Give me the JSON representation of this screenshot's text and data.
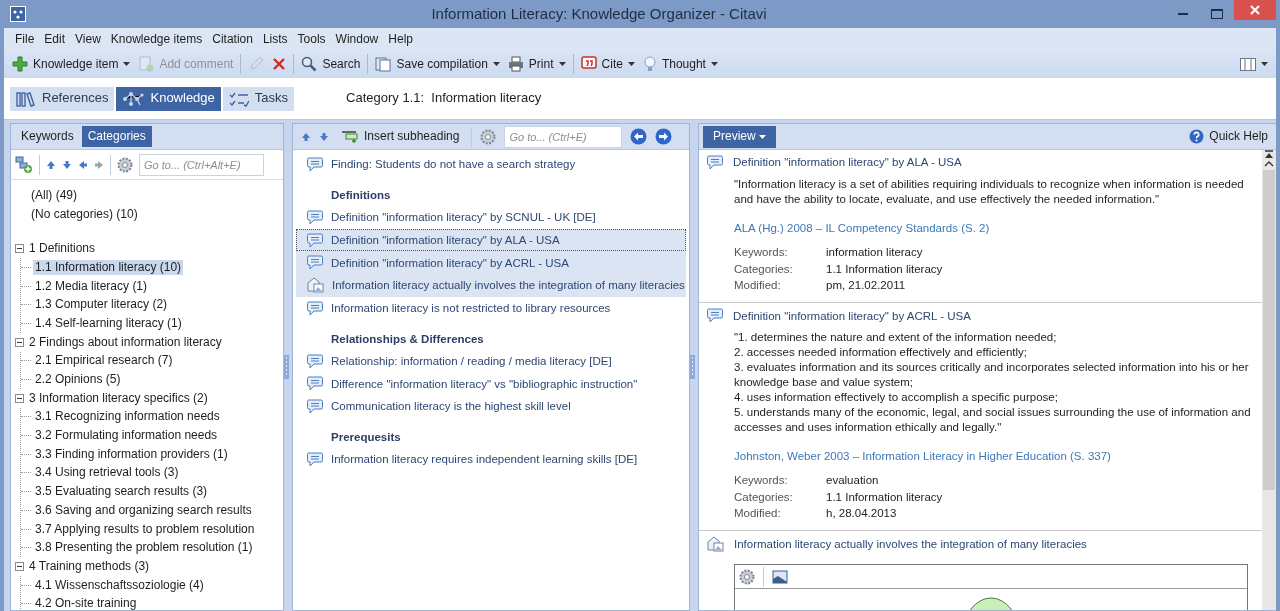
{
  "window": {
    "title": "Information Literacy: Knowledge Organizer - Citavi"
  },
  "menu": [
    "File",
    "Edit",
    "View",
    "Knowledge items",
    "Citation",
    "Lists",
    "Tools",
    "Window",
    "Help"
  ],
  "toolbar": [
    {
      "kind": "button",
      "label": "Knowledge item",
      "dropdown": true,
      "disabled": false
    },
    {
      "kind": "button",
      "label": "Add comment",
      "dropdown": false,
      "disabled": true
    },
    {
      "kind": "separator"
    },
    {
      "kind": "icon-button",
      "disabled": true
    },
    {
      "kind": "icon-button",
      "disabled": false
    },
    {
      "kind": "separator"
    },
    {
      "kind": "button",
      "label": "Search",
      "dropdown": false,
      "disabled": false
    },
    {
      "kind": "separator"
    },
    {
      "kind": "button",
      "label": "Save compilation",
      "dropdown": true,
      "disabled": false
    },
    {
      "kind": "button",
      "label": "Print",
      "dropdown": true,
      "disabled": false
    },
    {
      "kind": "separator"
    },
    {
      "kind": "button",
      "label": "Cite",
      "dropdown": true,
      "disabled": false
    },
    {
      "kind": "button",
      "label": "Thought",
      "dropdown": true,
      "disabled": false
    }
  ],
  "nav_tabs": [
    {
      "label": "References",
      "selected": false
    },
    {
      "label": "Knowledge",
      "selected": true
    },
    {
      "label": "Tasks",
      "selected": false
    }
  ],
  "heading": "Category 1.1:  Information literacy",
  "left": {
    "tabs": [
      {
        "label": "Keywords",
        "selected": false
      },
      {
        "label": "Categories",
        "selected": true
      }
    ],
    "goto_placeholder": "Go to... (Ctrl+Alt+E)",
    "tree": [
      {
        "label": "(All) (49)",
        "selected": false
      },
      {
        "label": "(No categories) (10)",
        "selected": false
      },
      {
        "label": "1 Definitions",
        "selected": false,
        "expanded": true,
        "children": [
          {
            "label": "1.1 Information literacy (10)",
            "selected": true
          },
          {
            "label": "1.2 Media literacy (1)",
            "selected": false
          },
          {
            "label": "1.3 Computer literacy (2)",
            "selected": false
          },
          {
            "label": "1.4 Self-learning literacy (1)",
            "selected": false
          }
        ]
      },
      {
        "label": "2 Findings about information literacy",
        "selected": false,
        "expanded": true,
        "children": [
          {
            "label": "2.1 Empirical research (7)",
            "selected": false
          },
          {
            "label": "2.2 Opinions (5)",
            "selected": false
          }
        ]
      },
      {
        "label": "3 Information literacy specifics (2)",
        "selected": false,
        "expanded": true,
        "children": [
          {
            "label": "3.1 Recognizing information needs",
            "selected": false
          },
          {
            "label": "3.2 Formulating information needs",
            "selected": false
          },
          {
            "label": "3.3 Finding information providers (1)",
            "selected": false
          },
          {
            "label": "3.4 Using retrieval tools (3)",
            "selected": false
          },
          {
            "label": "3.5 Evaluating search results (3)",
            "selected": false
          },
          {
            "label": "3.6 Saving and organizing search results",
            "selected": false
          },
          {
            "label": "3.7 Applying results to problem resolution",
            "selected": false
          },
          {
            "label": "3.8 Presenting the problem resolution (1)",
            "selected": false
          }
        ]
      },
      {
        "label": "4 Training methods (3)",
        "selected": false,
        "expanded": true,
        "children": [
          {
            "label": "4.1 Wissenschaftssoziologie (4)",
            "selected": false
          },
          {
            "label": "4.2 On-site training",
            "selected": false
          }
        ]
      }
    ]
  },
  "middle": {
    "insert_label": "Insert subheading",
    "goto_placeholder": "Go to... (Ctrl+E)",
    "items": [
      {
        "kind": "note",
        "label": "Finding: Students do not have a search strategy",
        "selected": false,
        "focused": false
      },
      {
        "kind": "heading",
        "label": "Definitions"
      },
      {
        "kind": "note",
        "label": "Definition \"information literacy\" by SCNUL - UK [DE]",
        "selected": false,
        "focused": false
      },
      {
        "kind": "note",
        "label": "Definition \"information literacy\" by ALA - USA",
        "selected": true,
        "focused": true
      },
      {
        "kind": "note",
        "label": "Definition \"information literacy\" by ACRL - USA",
        "selected": true,
        "focused": false
      },
      {
        "kind": "image-note",
        "label": "Information literacy actually involves the integration of many literacies",
        "selected": true,
        "focused": false
      },
      {
        "kind": "note",
        "label": "Information literacy is not restricted to library resources",
        "selected": false,
        "focused": false
      },
      {
        "kind": "heading",
        "label": "Relationships & Differences"
      },
      {
        "kind": "note",
        "label": "Relationship: information / reading / media literacy [DE]",
        "selected": false,
        "focused": false
      },
      {
        "kind": "note",
        "label": "Difference \"information literacy\" vs \"bibliographic instruction\"",
        "selected": false,
        "focused": false
      },
      {
        "kind": "note",
        "label": "Communication literacy is the highest skill level",
        "selected": false,
        "focused": false
      },
      {
        "kind": "heading",
        "label": "Prerequesits"
      },
      {
        "kind": "note",
        "label": "Information literacy requires independent learning skills [DE]",
        "selected": false,
        "focused": false
      }
    ]
  },
  "right": {
    "preview_label": "Preview",
    "help_label": "Quick Help",
    "entries": [
      {
        "kind": "note",
        "title": "Definition \"information literacy\" by ALA - USA",
        "quote": "\"Information literacy is a set of abilities requiring individuals to recognize when information is needed and have the ability to locate, evaluate, and use effectively the needed information.\"",
        "source": "ALA (Hg.) 2008 – IL Competency Standards (S. 2)",
        "fields": [
          {
            "label": "Keywords:",
            "value": "information literacy"
          },
          {
            "label": "Categories:",
            "value": "1.1 Information literacy"
          },
          {
            "label": "Modified:",
            "value": "pm, 21.02.2011"
          }
        ]
      },
      {
        "kind": "note",
        "title": "Definition \"information literacy\" by ACRL - USA",
        "quote": "\"1. determines the nature and extent of the information needed;\n2. accesses needed information effectively and efficiently;\n3. evaluates information and its sources critically and incorporates selected information into his or her knowledge base and value system;\n4. uses information effectively to accomplish a specific purpose;\n5. understands many of the economic, legal, and social issues surrounding the use of information and accesses and uses information ethically and legally.\"",
        "source": "Johnston, Weber 2003 – Information Literacy in Higher Education (S. 337)",
        "fields": [
          {
            "label": "Keywords:",
            "value": "evaluation"
          },
          {
            "label": "Categories:",
            "value": "1.1 Information literacy"
          },
          {
            "label": "Modified:",
            "value": "h, 28.04.2013"
          }
        ]
      },
      {
        "kind": "image-note",
        "title": "Information literacy actually involves the integration of many literacies"
      }
    ]
  }
}
